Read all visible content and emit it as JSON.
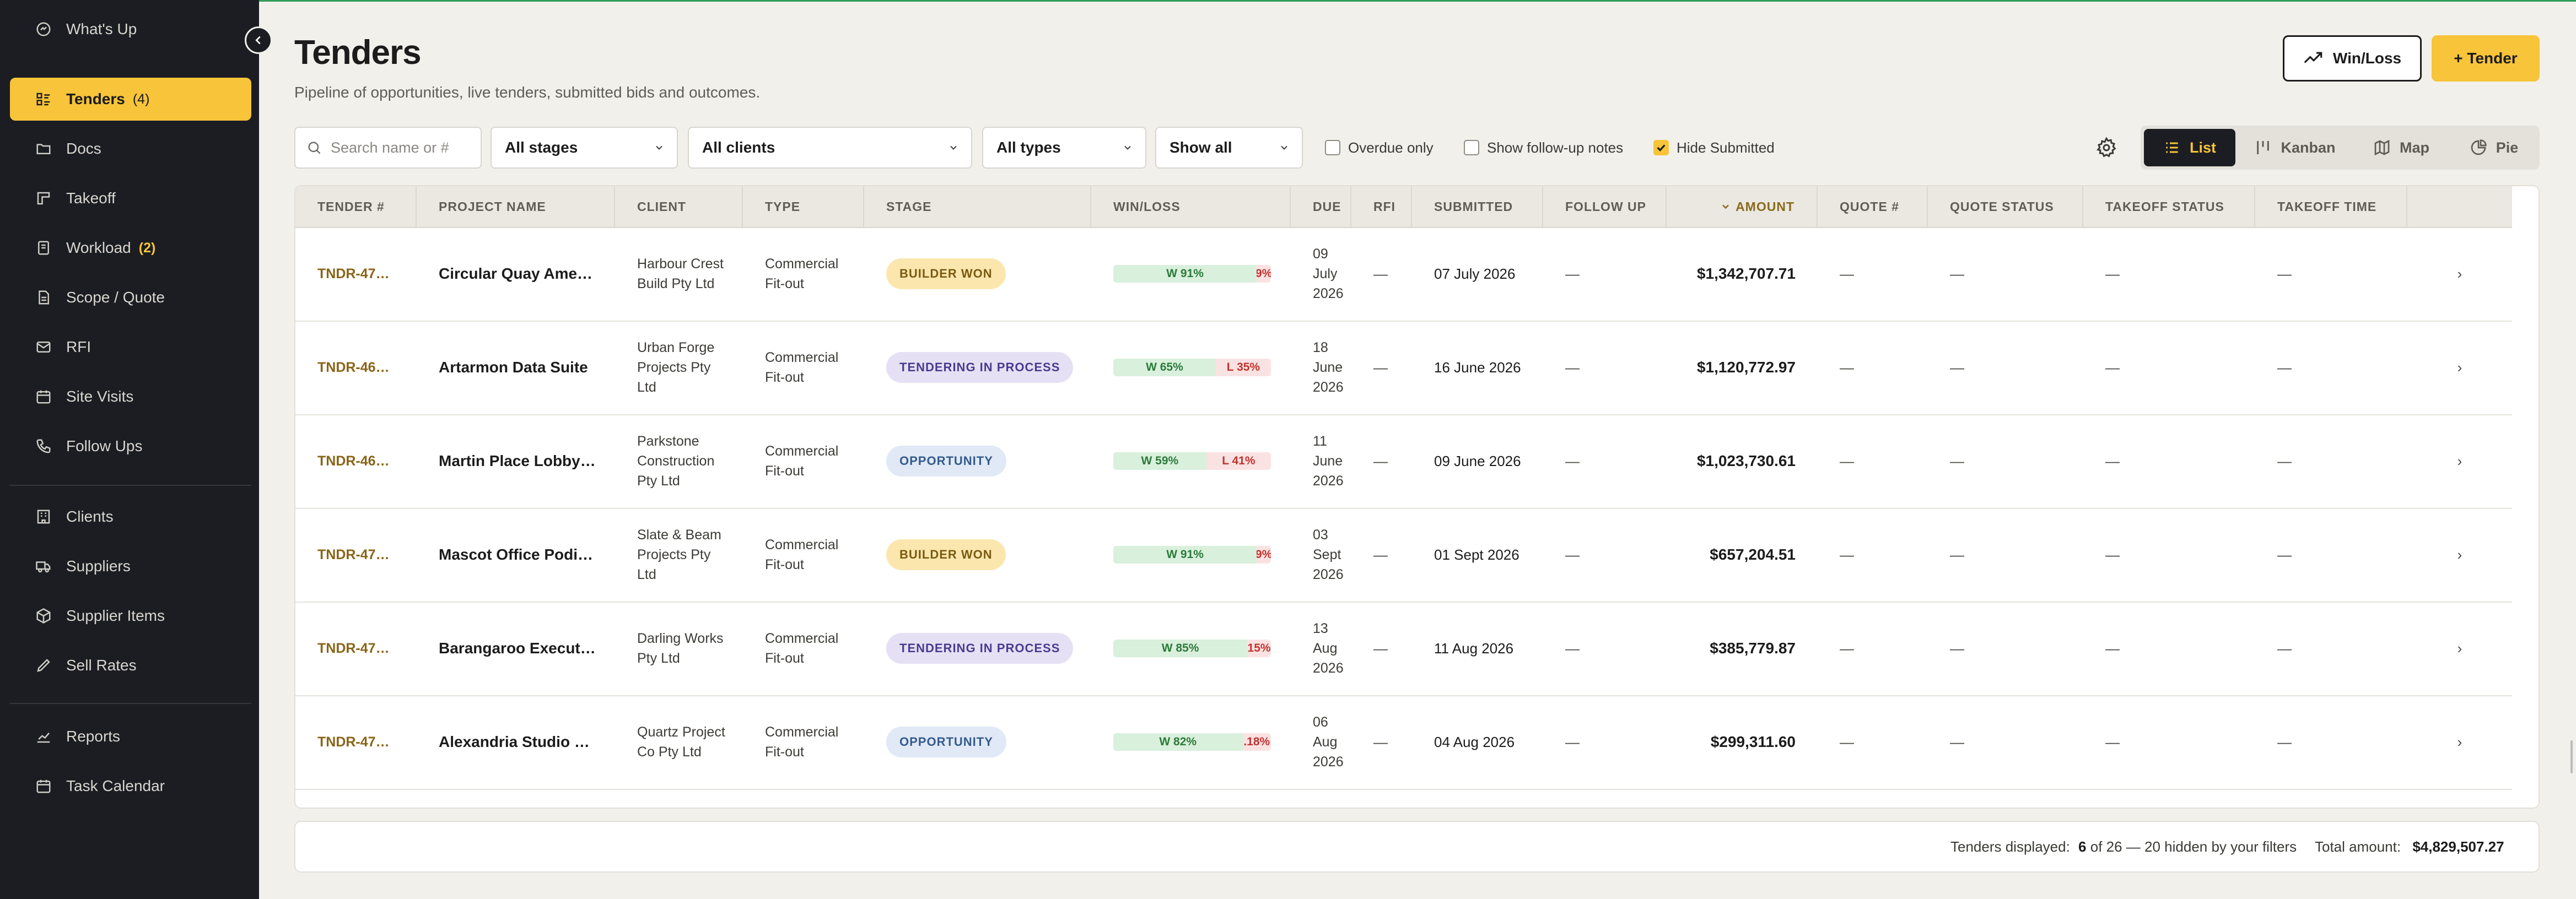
{
  "sidebar": {
    "items": [
      {
        "label": "What's Up",
        "icon": "activity-icon"
      },
      {
        "label": "Tenders",
        "count": "(4)",
        "icon": "list-icon",
        "active": true
      },
      {
        "label": "Docs",
        "icon": "folder-icon"
      },
      {
        "label": "Takeoff",
        "icon": "takeoff-icon"
      },
      {
        "label": "Workload",
        "count": "(2)",
        "icon": "workload-icon"
      },
      {
        "label": "Scope / Quote",
        "icon": "document-icon"
      },
      {
        "label": "RFI",
        "icon": "mail-icon"
      },
      {
        "label": "Site Visits",
        "icon": "calendar-icon"
      },
      {
        "label": "Follow Ups",
        "icon": "phone-icon"
      },
      {
        "label": "Clients",
        "icon": "building-icon"
      },
      {
        "label": "Suppliers",
        "icon": "truck-icon"
      },
      {
        "label": "Supplier Items",
        "icon": "package-icon"
      },
      {
        "label": "Sell Rates",
        "icon": "pen-icon"
      },
      {
        "label": "Reports",
        "icon": "chart-icon"
      },
      {
        "label": "Task Calendar",
        "icon": "calendar-icon"
      }
    ]
  },
  "header": {
    "title": "Tenders",
    "subtitle": "Pipeline of opportunities, live tenders, submitted bids and outcomes.",
    "winloss_label": "Win/Loss",
    "new_tender_label": "+ Tender"
  },
  "filters": {
    "search_placeholder": "Search name or #",
    "stages": "All stages",
    "clients": "All clients",
    "types": "All types",
    "show": "Show all",
    "overdue_only": "Overdue only",
    "show_follow_up_notes": "Show follow-up notes",
    "hide_submitted": "Hide Submitted",
    "overdue_checked": false,
    "follow_up_checked": false,
    "hide_submitted_checked": true
  },
  "views": {
    "list": "List",
    "kanban": "Kanban",
    "map": "Map",
    "pie": "Pie",
    "active": "List"
  },
  "table": {
    "columns": [
      "TENDER #",
      "PROJECT NAME",
      "CLIENT",
      "TYPE",
      "STAGE",
      "WIN/LOSS",
      "DUE",
      "RFI",
      "SUBMITTED",
      "FOLLOW UP",
      "AMOUNT",
      "QUOTE #",
      "QUOTE STATUS",
      "TAKEOFF STATUS",
      "TAKEOFF TIME"
    ],
    "sort_column": "AMOUNT",
    "rows": [
      {
        "tender": "TNDR-47…",
        "project": "Circular Quay Ame…",
        "client": "Harbour Crest Build Pty Ltd",
        "type": "Commercial Fit-out",
        "stage": "BUILDER WON",
        "stage_kind": "won",
        "win": "W 91%",
        "loss": "9%",
        "win_pct": 91,
        "due": "09 July 2026",
        "rfi": "—",
        "submitted": "07 July 2026",
        "follow_up": "—",
        "amount": "$1,342,707.71",
        "quote_no": "—",
        "quote_status": "—",
        "takeoff_status": "—",
        "takeoff_time": "—"
      },
      {
        "tender": "TNDR-46…",
        "project": "Artarmon Data Suite",
        "client": "Urban Forge Projects Pty Ltd",
        "type": "Commercial Fit-out",
        "stage": "TENDERING IN PROCESS",
        "stage_kind": "tip",
        "win": "W 65%",
        "loss": "L 35%",
        "win_pct": 65,
        "due": "18 June 2026",
        "rfi": "—",
        "submitted": "16 June 2026",
        "follow_up": "—",
        "amount": "$1,120,772.97",
        "quote_no": "—",
        "quote_status": "—",
        "takeoff_status": "—",
        "takeoff_time": "—"
      },
      {
        "tender": "TNDR-46…",
        "project": "Martin Place Lobby…",
        "client": "Parkstone Construction Pty Ltd",
        "type": "Commercial Fit-out",
        "stage": "OPPORTUNITY",
        "stage_kind": "opp",
        "win": "W 59%",
        "loss": "L 41%",
        "win_pct": 59,
        "due": "11 June 2026",
        "rfi": "—",
        "submitted": "09 June 2026",
        "follow_up": "—",
        "amount": "$1,023,730.61",
        "quote_no": "—",
        "quote_status": "—",
        "takeoff_status": "—",
        "takeoff_time": "—"
      },
      {
        "tender": "TNDR-47…",
        "project": "Mascot Office Podi…",
        "client": "Slate & Beam Projects Pty Ltd",
        "type": "Commercial Fit-out",
        "stage": "BUILDER WON",
        "stage_kind": "won",
        "win": "W 91%",
        "loss": "9%",
        "win_pct": 91,
        "due": "03 Sept 2026",
        "rfi": "—",
        "submitted": "01 Sept 2026",
        "follow_up": "—",
        "amount": "$657,204.51",
        "quote_no": "—",
        "quote_status": "—",
        "takeoff_status": "—",
        "takeoff_time": "—"
      },
      {
        "tender": "TNDR-47…",
        "project": "Barangaroo Execut…",
        "client": "Darling Works Pty Ltd",
        "type": "Commercial Fit-out",
        "stage": "TENDERING IN PROCESS",
        "stage_kind": "tip",
        "win": "W 85%",
        "loss": "15%",
        "win_pct": 85,
        "due": "13 Aug 2026",
        "rfi": "—",
        "submitted": "11 Aug 2026",
        "follow_up": "—",
        "amount": "$385,779.87",
        "quote_no": "—",
        "quote_status": "—",
        "takeoff_status": "—",
        "takeoff_time": "—"
      },
      {
        "tender": "TNDR-47…",
        "project": "Alexandria Studio …",
        "client": "Quartz Project Co Pty Ltd",
        "type": "Commercial Fit-out",
        "stage": "OPPORTUNITY",
        "stage_kind": "opp",
        "win": "W 82%",
        "loss": ".18%",
        "win_pct": 82,
        "due": "06 Aug 2026",
        "rfi": "—",
        "submitted": "04 Aug 2026",
        "follow_up": "—",
        "amount": "$299,311.60",
        "quote_no": "—",
        "quote_status": "—",
        "takeoff_status": "—",
        "takeoff_time": "—"
      }
    ]
  },
  "footer": {
    "displayed_label": "Tenders displayed:",
    "displayed_count": "6",
    "displayed_rest": "of 26 — 20 hidden by your filters",
    "total_label": "Total amount:",
    "total_value": "$4,829,507.27"
  },
  "colors": {
    "accent": "#f7c43a",
    "sidebar_bg": "#1b1d22",
    "page_bg": "#f2f0eb",
    "win_green": "#2c7a3b",
    "loss_red": "#c0342f"
  }
}
